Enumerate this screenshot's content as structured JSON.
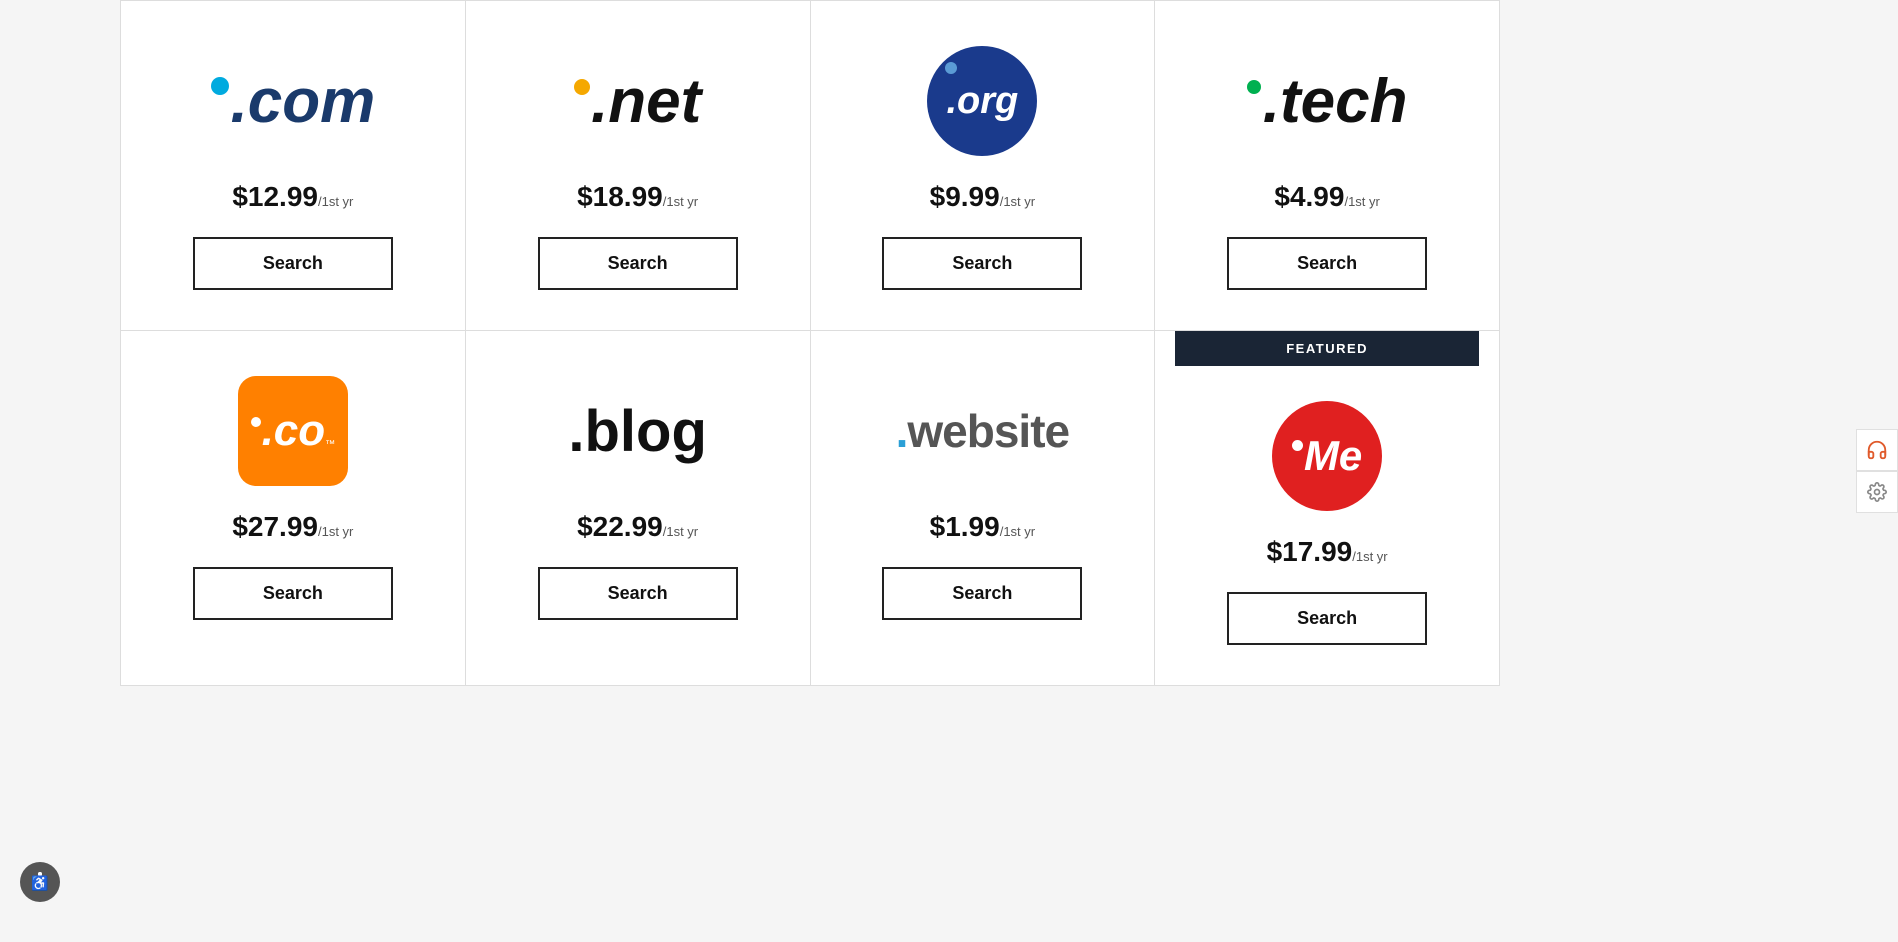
{
  "domains": [
    {
      "id": "com",
      "price_main": "$12.99",
      "price_period": "/1st yr",
      "search_label": "Search",
      "featured": false
    },
    {
      "id": "net",
      "price_main": "$18.99",
      "price_period": "/1st yr",
      "search_label": "Search",
      "featured": false
    },
    {
      "id": "org",
      "price_main": "$9.99",
      "price_period": "/1st yr",
      "search_label": "Search",
      "featured": false
    },
    {
      "id": "tech",
      "price_main": "$4.99",
      "price_period": "/1st yr",
      "search_label": "Search",
      "featured": false
    },
    {
      "id": "co",
      "price_main": "$27.99",
      "price_period": "/1st yr",
      "search_label": "Search",
      "featured": false
    },
    {
      "id": "blog",
      "price_main": "$22.99",
      "price_period": "/1st yr",
      "search_label": "Search",
      "featured": false
    },
    {
      "id": "website",
      "price_main": "$1.99",
      "price_period": "/1st yr",
      "search_label": "Search",
      "featured": false
    },
    {
      "id": "me",
      "price_main": "$17.99",
      "price_period": "/1st yr",
      "search_label": "Search",
      "featured": true,
      "featured_label": "FEATURED"
    }
  ],
  "sidebar": {
    "icon1": "headset",
    "icon2": "settings"
  },
  "accessibility": {
    "label": "Accessibility"
  }
}
